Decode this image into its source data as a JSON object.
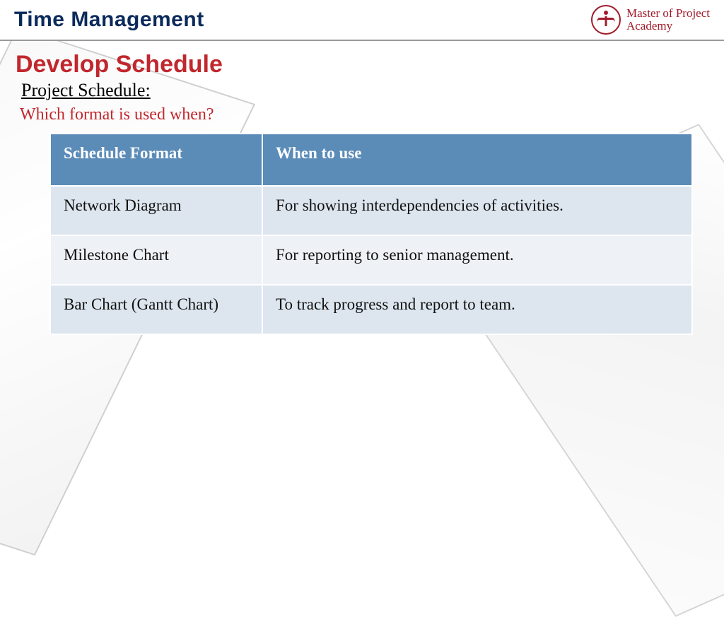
{
  "header": {
    "title": "Time Management",
    "brand_line1": "Master of Project",
    "brand_line2": "Academy"
  },
  "main": {
    "heading": "Develop Schedule",
    "subheading": "Project Schedule:",
    "question": "Which format is used when?",
    "table": {
      "col1": "Schedule Format",
      "col2": "When to use",
      "rows": [
        {
          "format": "Network Diagram",
          "when": "For showing interdependencies of activities."
        },
        {
          "format": "Milestone Chart",
          "when": "For reporting to senior management."
        },
        {
          "format": "Bar Chart (Gantt Chart)",
          "when": "To track progress and report to team."
        }
      ]
    }
  }
}
